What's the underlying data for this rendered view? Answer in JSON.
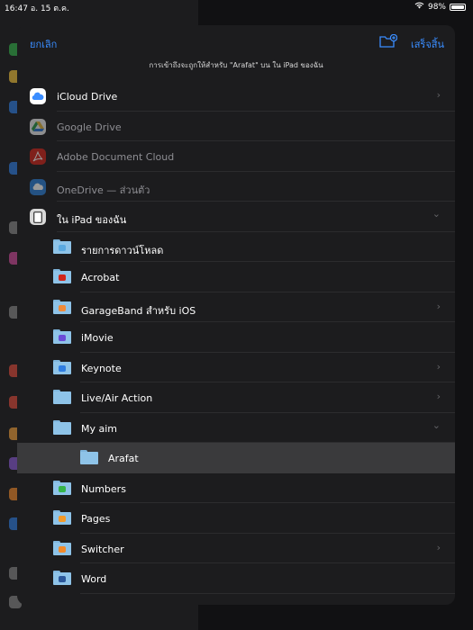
{
  "status": {
    "time": "16:47",
    "date": "อ. 15 ต.ค.",
    "battery": "98%"
  },
  "sheet": {
    "cancel_label": "ยกเลิก",
    "done_label": "เสร็จสิ้น",
    "subtitle": "การเข้าถึงจะถูกให้สำหรับ \"Arafat\" บน ใน iPad ของฉัน"
  },
  "locations": [
    {
      "label": "iCloud Drive",
      "icon": "icloud-icon",
      "color": "#ffffff",
      "enabled": true
    },
    {
      "label": "Google Drive",
      "icon": "google-drive-icon",
      "color": "#2aa04a",
      "enabled": false
    },
    {
      "label": "Adobe Document Cloud",
      "icon": "adobe-icon",
      "color": "#d0251a",
      "enabled": false
    },
    {
      "label": "OneDrive — ส่วนตัว",
      "icon": "onedrive-icon",
      "color": "#2c7fd6",
      "enabled": false
    },
    {
      "label": "ใน iPad ของฉัน",
      "icon": "ipad-icon",
      "color": "#d8d8d8",
      "enabled": true
    }
  ],
  "folders": [
    {
      "label": "รายการดาวน์โหลด",
      "badge_color": "#5aa9e0"
    },
    {
      "label": "Acrobat",
      "badge_color": "#d0251a"
    },
    {
      "label": "GarageBand สำหรับ iOS",
      "badge_color": "#ef8a3a"
    },
    {
      "label": "iMovie",
      "badge_color": "#6b4bd6"
    },
    {
      "label": "Keynote",
      "badge_color": "#2f7de1"
    },
    {
      "label": "Live/Air Action",
      "badge_color": "#8ec3e8"
    },
    {
      "label": "My aim",
      "badge_color": "#8ec3e8"
    },
    {
      "label": "Arafat",
      "badge_color": "#8ec3e8"
    },
    {
      "label": "Numbers",
      "badge_color": "#35b44a"
    },
    {
      "label": "Pages",
      "badge_color": "#f39a2b"
    },
    {
      "label": "Switcher",
      "badge_color": "#f28a2b"
    },
    {
      "label": "Word",
      "badge_color": "#2b579a"
    }
  ]
}
